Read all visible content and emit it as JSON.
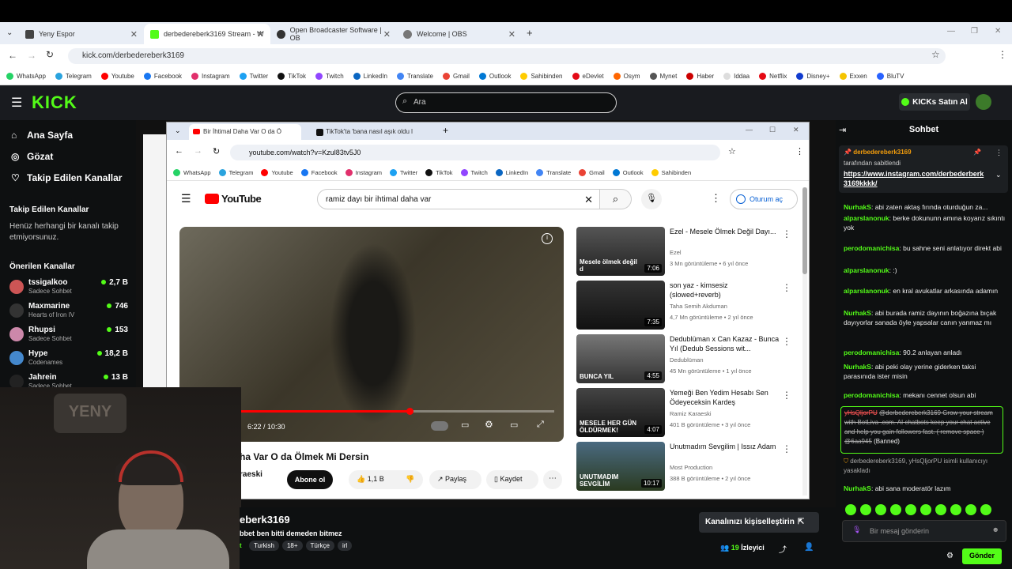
{
  "browser": {
    "tabs": [
      {
        "label": "Yeny Espor",
        "color": "#555"
      },
      {
        "label": "derbedereberk3169 Stream - W",
        "color": "#53fc18"
      },
      {
        "label": "Open Broadcaster Software | OB",
        "color": "#333"
      },
      {
        "label": "Welcome | OBS",
        "color": "#555"
      }
    ],
    "url": "kick.com/derbedereberk3169",
    "bookmarks": [
      "WhatsApp",
      "Telegram",
      "Youtube",
      "Facebook",
      "Instagram",
      "Twitter",
      "TikTok",
      "Twitch",
      "LinkedIn",
      "Translate",
      "Gmail",
      "Outlook",
      "Sahibinden",
      "eDevlet",
      "Osym",
      "Mynet",
      "Haber",
      "Iddaa",
      "Netflix",
      "Disney+",
      "Exxen",
      "BluTV"
    ]
  },
  "kick": {
    "logo": "KICK",
    "search_placeholder": "Ara",
    "buy_label": "KICKs Satın Al",
    "nav": [
      "Ana Sayfa",
      "Gözat",
      "Takip Edilen Kanallar"
    ],
    "followed_title": "Takip Edilen Kanallar",
    "followed_empty": "Henüz herhangi bir kanalı takip etmiyorsunuz.",
    "recommended_title": "Önerilen Kanallar",
    "recommended": [
      {
        "name": "tssigalkoo",
        "sub": "Sadece Sohbet",
        "count": "2,7 B",
        "color": "#c55"
      },
      {
        "name": "Maxmarine",
        "sub": "Hearts of Iron IV",
        "count": "746",
        "color": "#333"
      },
      {
        "name": "Rhupsi",
        "sub": "Sadece Sohbet",
        "count": "153",
        "color": "#c8a"
      },
      {
        "name": "Hype",
        "sub": "Codenames",
        "count": "18,2 B",
        "color": "#48c"
      },
      {
        "name": "Jahrein",
        "sub": "Sadece Sohbet",
        "count": "13 B",
        "color": "#222"
      }
    ],
    "channel_name": "eberk3169",
    "channel_title": "bbet ben bitti demeden bitmez",
    "tags": [
      "Turkish",
      "18+",
      "Türkçe",
      "irl"
    ],
    "customize_label": "Kanalınızı kişiselleştirin",
    "viewers": "19",
    "viewers_label": "İzleyici"
  },
  "inner": {
    "tabs": [
      "Bir İhtimal Daha Var O da Ö",
      "TikTok'ta 'bana nasıl aşık oldu l"
    ],
    "url": "youtube.com/watch?v=Kzul83tv5J0",
    "search_value": "ramiz dayı bir ihtimal daha var",
    "signin": "Oturum aç",
    "time": "6:22 / 10:30",
    "video_title": "ha Var O da Ölmek Mi Dersin",
    "channel": "raeski",
    "subscribe": "Abone ol",
    "likes": "1,1 B",
    "share": "Paylaş",
    "save": "Kaydet",
    "related": [
      {
        "title": "Ezel - Mesele Ölmek Değil Dayı...",
        "channel": "Ezel",
        "meta": "3 Mn görüntüleme • 6 yıl önce",
        "dur": "7:06",
        "cap": "Mesele ölmek değil d"
      },
      {
        "title": "son yaz - kimsesiz (slowed+reverb)",
        "channel": "Taha Semih Akduman",
        "meta": "4,7 Mn görüntüleme • 2 yıl önce",
        "dur": "7:35",
        "cap": ""
      },
      {
        "title": "Dedublüman x Can Kazaz - Bunca Yıl (Dedub Sessions wit...",
        "channel": "Dedublüman",
        "meta": "45 Mn görüntüleme • 1 yıl önce",
        "dur": "4:55",
        "cap": "BUNCA YIL"
      },
      {
        "title": "Yemeği Ben Yedim Hesabı Sen Ödeyeceksin Kardeş",
        "channel": "Ramiz Karaeski",
        "meta": "401 B görüntüleme • 3 yıl önce",
        "dur": "4:07",
        "cap": "MESELE HER GÜN ÖLDÜRMEK!"
      },
      {
        "title": "Unutmadım Sevgilim | Issız Adam",
        "channel": "Most Production",
        "meta": "388 B görüntüleme • 2 yıl önce",
        "dur": "10:17",
        "cap": "UNUTMADIM SEVGİLİM"
      }
    ]
  },
  "chat": {
    "title": "Sohbet",
    "pinned_user": "derbedereberk3169",
    "pinned_by": "tarafından sabitlendi",
    "pinned_link": "https://www.instagram.com/derbederberk3169kkkk/",
    "messages": [
      {
        "user": "NurhakS",
        "text": "abi zaten aktaş fırında oturduğun za..."
      },
      {
        "user": "alparslanonuk",
        "text": "berke dokununn amına koyarız sıkıntı yok"
      },
      {
        "user": "perodomanichisa",
        "text": "bu sahne seni anlatıyor direkt abi"
      },
      {
        "user": "alparslanonuk",
        "text": ":)"
      },
      {
        "user": "alparslanonuk",
        "text": "en kral avukatlar arkasında adamın"
      },
      {
        "user": "NurhakS",
        "text": "abi burada ramiz dayının boğazına bıçak dayıyorlar sanada öyle yapsalar canın yanmaz mı"
      },
      {
        "user": "perodomanichisa",
        "text": "90.2 anlayan anladı"
      },
      {
        "user": "NurhakS",
        "text": "abi peki olay yerine giderken taksi parasınıda ister misin"
      },
      {
        "user": "perodomanichisa",
        "text": "mekanı cennet olsun abi"
      }
    ],
    "banned_user": "yHsQljorPU",
    "banned_text": "@derbedereberk3169 Grow your stream with BotLiva .com. AI chatbots keep your chat active and help you gain followers fast. ( remove space ) @6aa945",
    "banned_tag": "(Banned)",
    "mod_note": "derbedereberk3169, yHsQljorPU isimli kullanıcıyı yasakladı",
    "last_msg": {
      "user": "NurhakS",
      "text": "abi sana moderatör lazım"
    },
    "input_placeholder": "Bir mesaj gönderin",
    "send": "Gönder"
  }
}
